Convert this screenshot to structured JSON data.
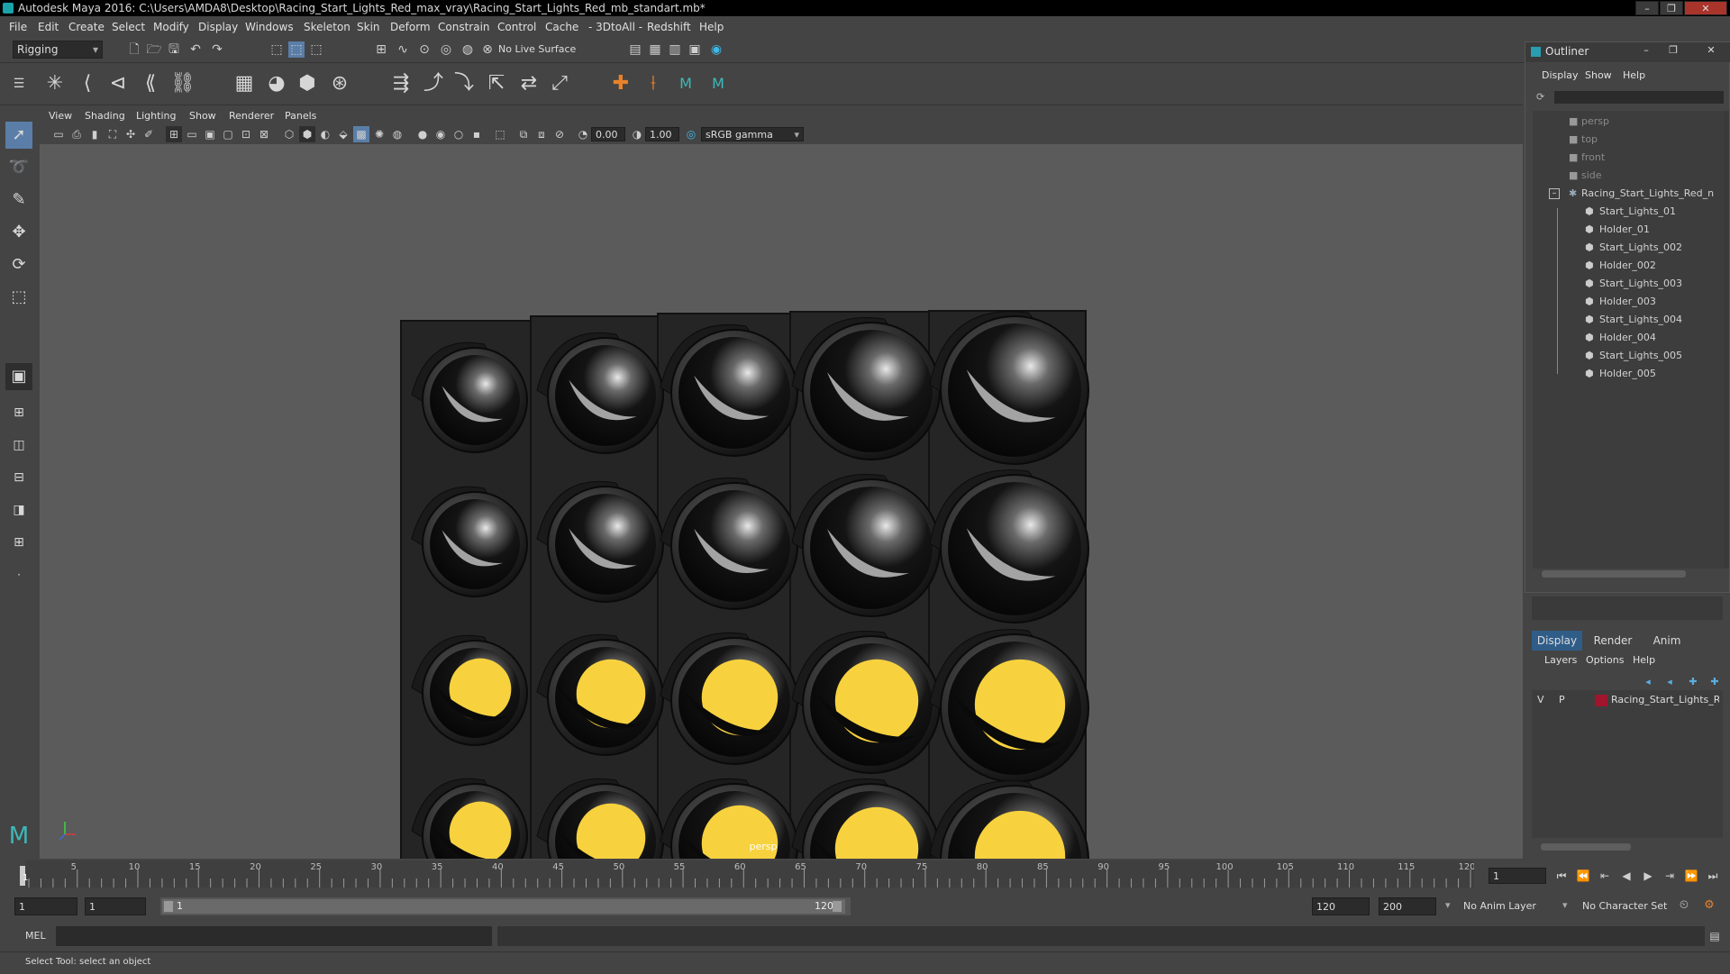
{
  "window": {
    "title": "Autodesk Maya 2016: C:\\Users\\AMDA8\\Desktop\\Racing_Start_Lights_Red_max_vray\\Racing_Start_Lights_Red_mb_standart.mb*"
  },
  "menu": [
    "File",
    "Edit",
    "Create",
    "Select",
    "Modify",
    "Display",
    "Windows",
    "Skeleton",
    "Skin",
    "Deform",
    "Constrain",
    "Control",
    "Cache",
    "- 3DtoAll -",
    "Redshift",
    "Help"
  ],
  "status_line": {
    "mode": "Rigging",
    "live_surface": "No Live Surface"
  },
  "panel_menu": [
    "View",
    "Shading",
    "Lighting",
    "Show",
    "Renderer",
    "Panels"
  ],
  "panel_toolbar": {
    "value_a": "0.00",
    "value_b": "1.00",
    "color_space": "sRGB gamma"
  },
  "viewport": {
    "camera_label": "persp"
  },
  "lights": {
    "lit_color": "#f7d23e",
    "body_color": "#252525",
    "rows_lit": [
      false,
      false,
      true,
      true
    ]
  },
  "outliner": {
    "title": "Outliner",
    "menu": [
      "Display",
      "Show",
      "Help"
    ],
    "items": [
      {
        "label": "persp",
        "type": "camera"
      },
      {
        "label": "top",
        "type": "camera"
      },
      {
        "label": "front",
        "type": "camera"
      },
      {
        "label": "side",
        "type": "camera"
      },
      {
        "label": "Racing_Start_Lights_Red_n",
        "type": "group"
      },
      {
        "label": "Start_Lights_01",
        "type": "mesh"
      },
      {
        "label": "Holder_01",
        "type": "mesh"
      },
      {
        "label": "Start_Lights_002",
        "type": "mesh"
      },
      {
        "label": "Holder_002",
        "type": "mesh"
      },
      {
        "label": "Start_Lights_003",
        "type": "mesh"
      },
      {
        "label": "Holder_003",
        "type": "mesh"
      },
      {
        "label": "Start_Lights_004",
        "type": "mesh"
      },
      {
        "label": "Holder_004",
        "type": "mesh"
      },
      {
        "label": "Start_Lights_005",
        "type": "mesh"
      },
      {
        "label": "Holder_005",
        "type": "mesh"
      }
    ]
  },
  "layer_editor": {
    "tabs": [
      "Display",
      "Render",
      "Anim"
    ],
    "menu": [
      "Layers",
      "Options",
      "Help"
    ],
    "layer": {
      "v": "V",
      "p": "P",
      "name": "Racing_Start_Lights_Re",
      "color": "#a0142c"
    }
  },
  "timeline": {
    "ticks": [
      "5",
      "10",
      "15",
      "20",
      "25",
      "30",
      "35",
      "40",
      "45",
      "50",
      "55",
      "60",
      "65",
      "70",
      "75",
      "80",
      "85",
      "90",
      "95",
      "100",
      "105",
      "110",
      "115",
      "120"
    ],
    "current_frame": "1",
    "playhead_label": "1"
  },
  "range": {
    "start": "1",
    "inner_start": "1",
    "slider_start": "1",
    "slider_end": "120",
    "end": "120",
    "max": "200",
    "anim_layer": "No Anim Layer",
    "char_set": "No Character Set"
  },
  "cmd": {
    "label": "MEL"
  },
  "help": {
    "text": "Select Tool: select an object"
  }
}
